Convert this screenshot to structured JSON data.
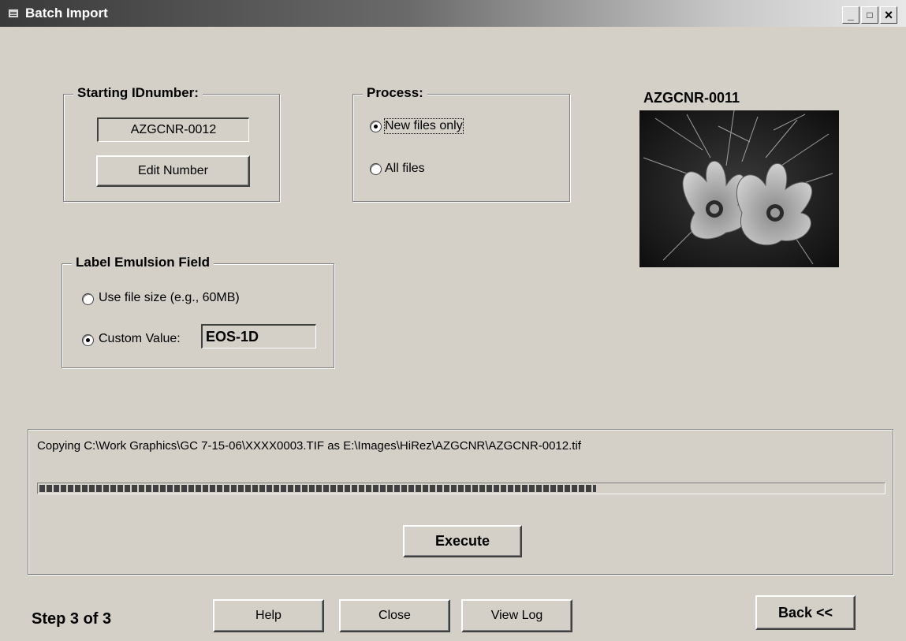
{
  "window": {
    "title": "Batch Import",
    "controls": {
      "minimize": "_",
      "maximize": "□",
      "close": "×"
    }
  },
  "starting_id": {
    "group_title": "Starting IDnumber:",
    "value": "AZGCNR-0012",
    "edit_button": "Edit Number"
  },
  "process": {
    "group_title": "Process:",
    "options": [
      {
        "label": "New files only",
        "checked": true
      },
      {
        "label": "All files",
        "checked": false
      }
    ]
  },
  "preview": {
    "caption": "AZGCNR-0011"
  },
  "emulsion": {
    "group_title": "Label Emulsion Field",
    "options": [
      {
        "label": "Use file size (e.g., 60MB)",
        "checked": false
      },
      {
        "label": "Custom Value:",
        "checked": true
      }
    ],
    "custom_value": "EOS-1D"
  },
  "status": {
    "message": "Copying C:\\Work Graphics\\GC 7-15-06\\XXXX0003.TIF as E:\\Images\\HiRez\\AZGCNR\\AZGCNR-0012.tif",
    "progress": 0.66,
    "execute_button": "Execute"
  },
  "footer": {
    "step": "Step 3 of 3",
    "help_button": "Help",
    "close_button": "Close",
    "view_log_button": "View Log",
    "back_button": "Back <<"
  }
}
